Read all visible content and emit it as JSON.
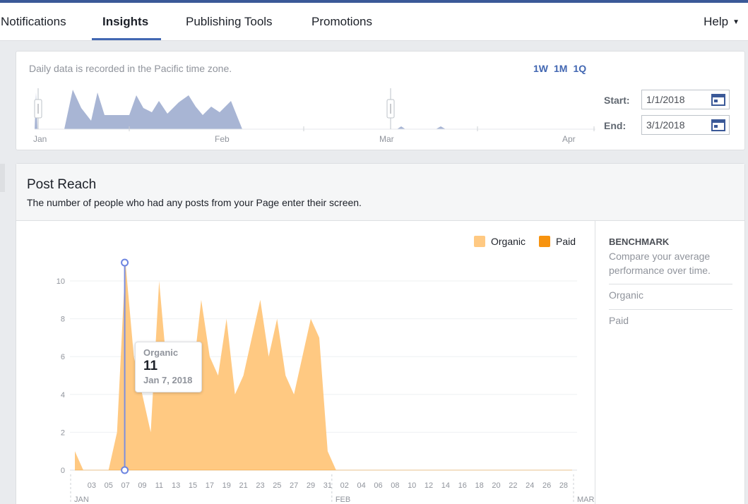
{
  "nav": {
    "tabs": [
      {
        "label": "Notifications"
      },
      {
        "label": "Insights"
      },
      {
        "label": "Publishing Tools"
      },
      {
        "label": "Promotions"
      }
    ],
    "active_tab": "Insights",
    "help_label": "Help"
  },
  "timeline": {
    "timezone_note": "Daily data is recorded in the Pacific time zone.",
    "range_buttons": [
      "1W",
      "1M",
      "1Q"
    ],
    "start_label": "Start:",
    "start_value": "1/1/2018",
    "end_label": "End:",
    "end_value": "3/1/2018",
    "month_labels": [
      "Jan",
      "Feb",
      "Mar",
      "Apr"
    ]
  },
  "post_reach": {
    "title": "Post Reach",
    "subtitle": "The number of people who had any posts from your Page enter their screen."
  },
  "benchmark": {
    "title": "BENCHMARK",
    "description": "Compare your average performance over time.",
    "items": [
      "Organic",
      "Paid"
    ]
  },
  "tooltip": {
    "series": "Organic",
    "value": "11",
    "date": "Jan 7, 2018"
  },
  "colors": {
    "organic": "#ffc982",
    "paid": "#f7930f",
    "accent": "#4267b2",
    "overview_area": "#a8b5d4"
  },
  "chart_data": {
    "type": "area",
    "legend": [
      "Organic",
      "Paid"
    ],
    "legend_position": "top-right",
    "ylim": [
      0,
      11
    ],
    "y_ticks": [
      0,
      2,
      4,
      6,
      8,
      10
    ],
    "x_tick_labels": [
      "03",
      "05",
      "07",
      "09",
      "11",
      "13",
      "15",
      "17",
      "19",
      "21",
      "23",
      "25",
      "27",
      "29",
      "31",
      "02",
      "04",
      "06",
      "08",
      "10",
      "12",
      "14",
      "16",
      "18",
      "20",
      "22",
      "24",
      "26",
      "28"
    ],
    "month_labels": [
      "JAN",
      "FEB",
      "MAR"
    ],
    "x_days": [
      1,
      2,
      3,
      4,
      5,
      6,
      7,
      8,
      9,
      10,
      11,
      12,
      13,
      14,
      15,
      16,
      17,
      18,
      19,
      20,
      21,
      22,
      23,
      24,
      25,
      26,
      27,
      28,
      29,
      30,
      31,
      32,
      33,
      34,
      35,
      36,
      37,
      38,
      39,
      40,
      41,
      42,
      43,
      44,
      45,
      46,
      47,
      48,
      49,
      50,
      51,
      52,
      53,
      54,
      55,
      56,
      57,
      58,
      59,
      60
    ],
    "series": [
      {
        "name": "Organic",
        "values": [
          1,
          0,
          0,
          0,
          0,
          2,
          11,
          6,
          4,
          2,
          10,
          5,
          5,
          6,
          5,
          9,
          6,
          5,
          8,
          4,
          5,
          7,
          9,
          6,
          8,
          5,
          4,
          6,
          8,
          7,
          1,
          0,
          0,
          0,
          0,
          0,
          0,
          0,
          0,
          0,
          0,
          0,
          0,
          0,
          0,
          0,
          0,
          0,
          0,
          0,
          0,
          0,
          0,
          0,
          0,
          0,
          0,
          0,
          0,
          0
        ]
      },
      {
        "name": "Paid",
        "values": [
          0,
          0,
          0,
          0,
          0,
          0,
          0,
          0,
          0,
          0,
          0,
          0,
          0,
          0,
          0,
          0,
          0,
          0,
          0,
          0,
          0,
          0,
          0,
          0,
          0,
          0,
          0,
          0,
          0,
          0,
          0,
          0,
          0,
          0,
          0,
          0,
          0,
          0,
          0,
          0,
          0,
          0,
          0,
          0,
          0,
          0,
          0,
          0,
          0,
          0,
          0,
          0,
          0,
          0,
          0,
          0,
          0,
          0,
          0,
          0
        ]
      }
    ],
    "highlight": {
      "x": 7,
      "y": 11
    }
  }
}
